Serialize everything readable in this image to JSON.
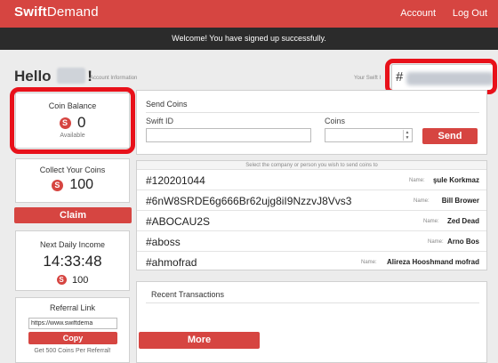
{
  "header": {
    "logo_bold": "Swift",
    "logo_rest": "Demand",
    "account_label": "Account",
    "logout_label": "Log Out"
  },
  "banner": {
    "text": "Welcome! You have signed up successfully."
  },
  "greeting": {
    "hello": "Hello",
    "exclaim": "!",
    "account_info": "Account Information",
    "swift_id_label": "Your Swift I",
    "swift_id_hash": "#"
  },
  "coin_balance": {
    "title": "Coin Balance",
    "value": "0",
    "caption": "Available",
    "icon_name": "coin-icon",
    "icon_glyph": "S"
  },
  "collect": {
    "title": "Collect Your Coins",
    "value": "100",
    "claim_label": "Claim"
  },
  "daily_income": {
    "title": "Next Daily Income",
    "time": "14:33:48",
    "value": "100"
  },
  "referral": {
    "title": "Referral Link",
    "link_value": "https://www.swiftdema",
    "copy_label": "Copy",
    "caption": "Get 500 Coins Per Referral!"
  },
  "send_coins": {
    "title": "Send Coins",
    "swift_id_label": "Swift ID",
    "coins_label": "Coins",
    "swift_id_value": "",
    "coins_value": "",
    "send_label": "Send"
  },
  "recipients": {
    "header": "Select the company or person you wish to send coins to",
    "name_label": "Name:",
    "rows": [
      {
        "id": "#120201044",
        "name": "şule Korkmaz"
      },
      {
        "id": "#6nW8SRDE6g666Br62ujg8iI9NzzvJ8Vvs3",
        "name": "Bill Brower"
      },
      {
        "id": "#ABOCAU2S",
        "name": "Zed Dead"
      },
      {
        "id": "#aboss",
        "name": "Arno Bos"
      },
      {
        "id": "#ahmofrad",
        "name": "Alireza Hooshmand mofrad"
      }
    ],
    "more_label": "More"
  },
  "transactions": {
    "title": "Recent Transactions"
  },
  "colors": {
    "brand": "#d64541",
    "banner": "#2b2b2b",
    "highlight_ring": "#e8111a"
  }
}
